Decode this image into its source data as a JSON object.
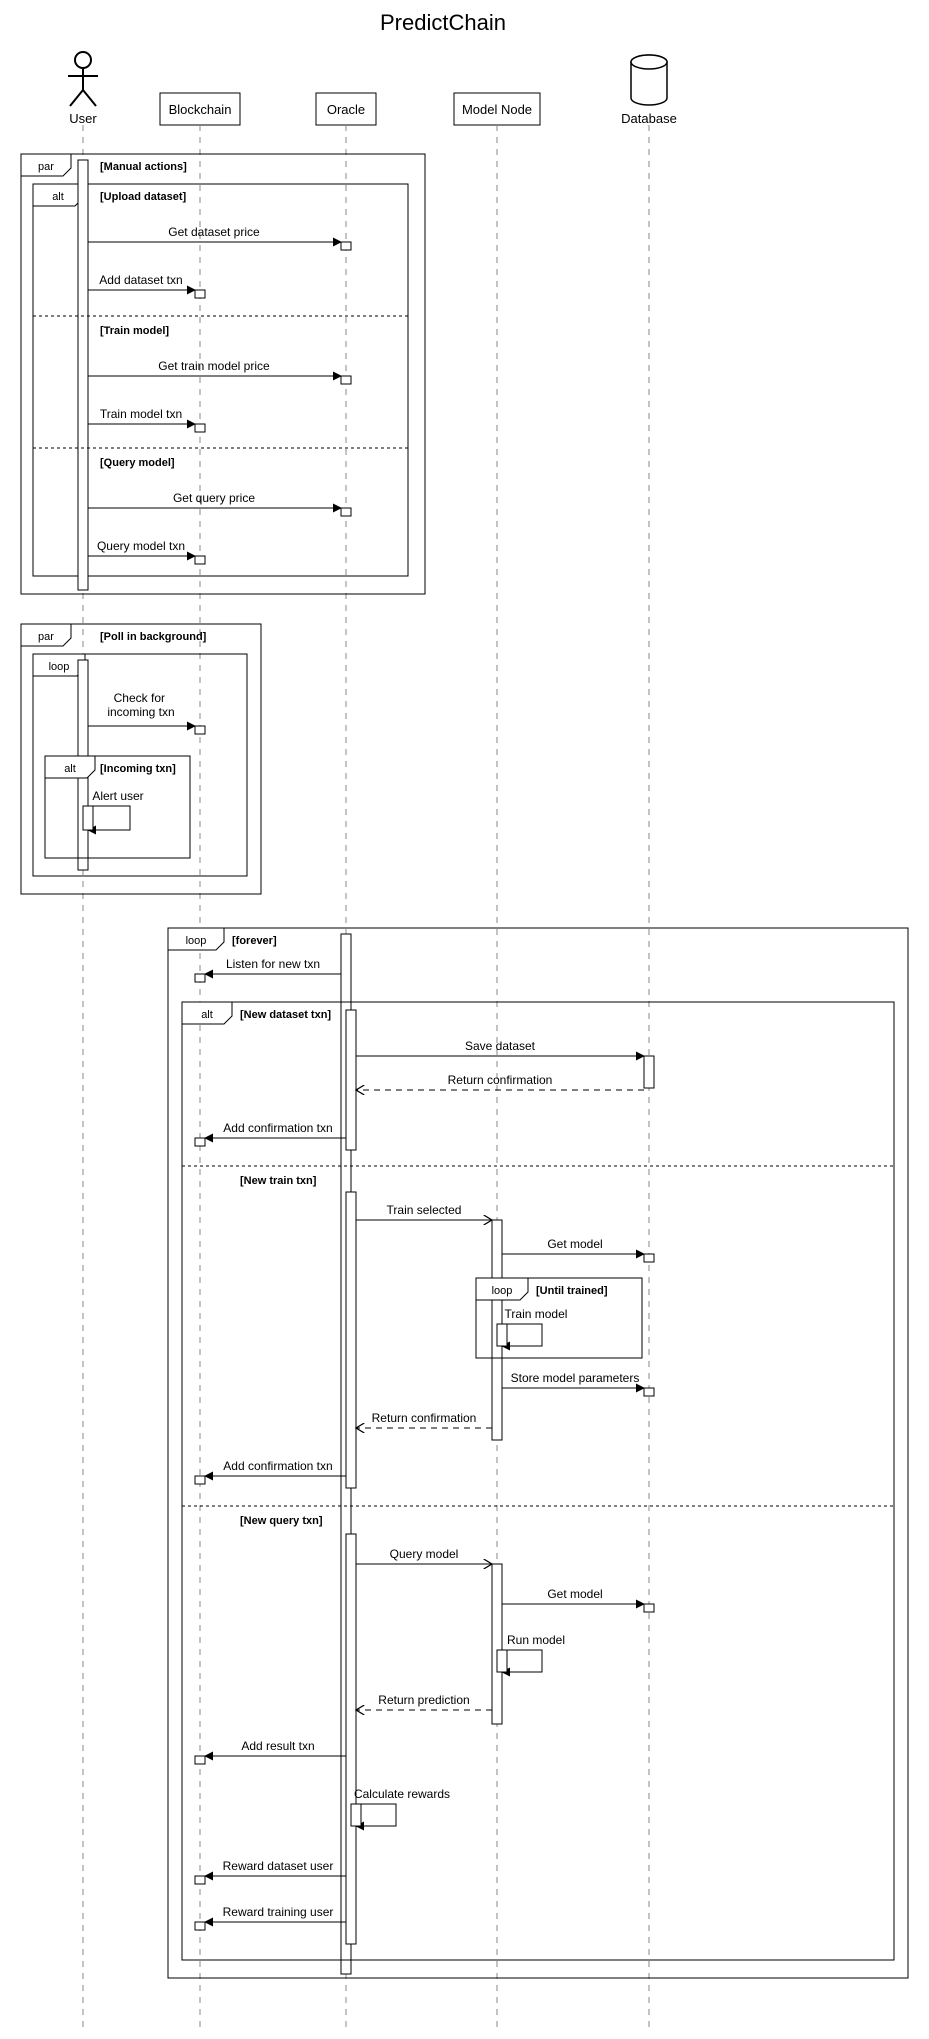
{
  "title": "PredictChain",
  "participants": {
    "user": "User",
    "blockchain": "Blockchain",
    "oracle": "Oracle",
    "modelnode": "Model Node",
    "database": "Database"
  },
  "fragments": {
    "par1": "par",
    "par1_guard": "[Manual actions]",
    "alt1": "alt",
    "alt1_g1": "[Upload dataset]",
    "alt1_g2": "[Train model]",
    "alt1_g3": "[Query model]",
    "par2": "par",
    "par2_guard": "[Poll in background]",
    "loop1": "loop",
    "alt2": "alt",
    "alt2_guard": "[Incoming txn]",
    "loop2": "loop",
    "loop2_guard": "[forever]",
    "alt3": "alt",
    "alt3_g1": "[New dataset txn]",
    "alt3_g2": "[New train txn]",
    "alt3_g3": "[New query txn]",
    "loop3": "loop",
    "loop3_guard": "[Until trained]"
  },
  "messages": {
    "m1": "Get dataset price",
    "m2": "Add dataset txn",
    "m3": "Get train model price",
    "m4": "Train model txn",
    "m5": "Get query price",
    "m6": "Query model txn",
    "m7": "Check for\nincoming txn",
    "m8": "Alert user",
    "m9": "Listen for new txn",
    "m10": "Save dataset",
    "m11": "Return confirmation",
    "m12": "Add confirmation txn",
    "m13": "Train selected",
    "m14": "Get model",
    "m15": "Train model",
    "m16": "Store model parameters",
    "m17": "Return confirmation",
    "m18": "Add confirmation txn",
    "m19": "Query model",
    "m20": "Get model",
    "m21": "Run model",
    "m22": "Return prediction",
    "m23": "Add result txn",
    "m24": "Calculate rewards",
    "m25": "Reward dataset user",
    "m26": "Reward training user"
  }
}
